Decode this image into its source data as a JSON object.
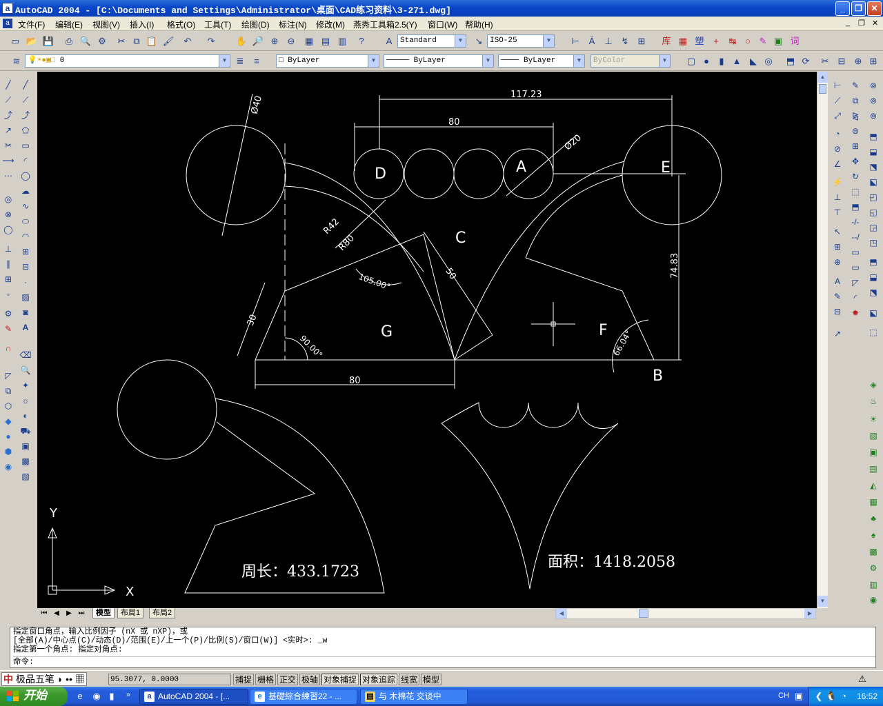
{
  "window": {
    "app_icon": "a",
    "title": "AutoCAD 2004 - [C:\\Documents and Settings\\Administrator\\桌面\\CAD练习资料\\3-271.dwg]",
    "controls": [
      "_",
      "❐",
      "✕"
    ]
  },
  "menu": {
    "items": [
      "文件(F)",
      "编辑(E)",
      "视图(V)",
      "插入(I)",
      "格式(O)",
      "工具(T)",
      "绘图(D)",
      "标注(N)",
      "修改(M)",
      "燕秀工具箱2.5(Y)",
      "窗口(W)",
      "帮助(H)"
    ],
    "mdi_controls": [
      "_",
      "❐",
      "✕"
    ]
  },
  "toolbar": {
    "text_style": "Standard",
    "dim_style": "ISO-25",
    "layer": "0",
    "color": "ByLayer",
    "linetype": "ByLayer",
    "lineweight": "ByLayer",
    "plotstyle": "ByColor"
  },
  "drawing": {
    "dim_overall_top": "117.23",
    "dim_80_top": "80",
    "dim_dia40": "Ø40",
    "dim_dia20": "Ø20",
    "dim_R42": "R42",
    "dim_R80": "R80",
    "dim_50": "50",
    "dim_105": "105.00°",
    "dim_30": "30",
    "dim_90": "90.00°",
    "dim_80_bottom": "80",
    "dim_7483": "74.83",
    "dim_6604": "66.04°",
    "label_A": "A",
    "label_B": "B",
    "label_C": "C",
    "label_D": "D",
    "label_E": "E",
    "label_F": "F",
    "label_G": "G",
    "ucs_x": "X",
    "ucs_y": "Y",
    "perimeter_text": "周长：433.1723",
    "area_text": "面积：1418.2058"
  },
  "layout_tabs": [
    "模型",
    "布局1",
    "布局2"
  ],
  "command": {
    "history": [
      "指定窗口角点，输入比例因子 (nX 或 nXP)，或",
      "[全部(A)/中心点(C)/动态(D)/范围(E)/上一个(P)/比例(S)/窗口(W)] <实时>: _w",
      "指定第一个角点: 指定对角点:"
    ],
    "prompt": "命令:"
  },
  "status": {
    "ime": "极品五笔",
    "coords": "95.3077, 0.0000",
    "toggles": [
      "捕捉",
      "栅格",
      "正交",
      "极轴",
      "对象捕捉",
      "对象追踪",
      "线宽",
      "模型"
    ]
  },
  "taskbar": {
    "start": "开始",
    "tasks": [
      "AutoCAD 2004 - [...",
      "基礎綜合練習22 - ...",
      "与 木棉花 交谈中"
    ],
    "lang": "CH",
    "clock": "16:52"
  }
}
